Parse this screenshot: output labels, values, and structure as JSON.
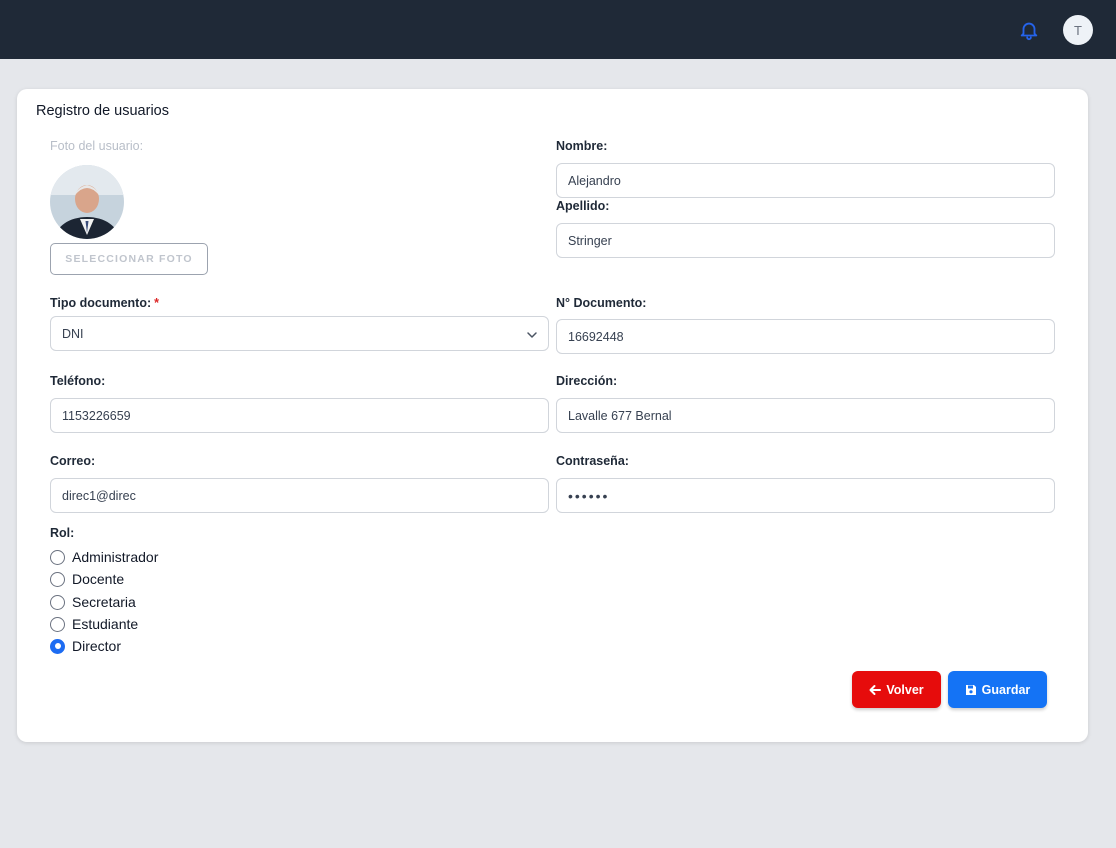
{
  "header": {
    "avatar_initial": "T",
    "icons": [
      "bell-icon"
    ],
    "accent_color": "#2563eb",
    "bar_color": "#1f2937"
  },
  "form": {
    "title": "Registro de usuarios",
    "photo": {
      "label": "Foto del usuario:",
      "button_label": "SELECCIONAR FOTO"
    },
    "nombre": {
      "label": "Nombre:",
      "value": "Alejandro"
    },
    "apellido": {
      "label": "Apellido:",
      "value": "Stringer"
    },
    "tipo_documento": {
      "label": "Tipo documento:",
      "required_mark": "*",
      "value": "DNI"
    },
    "nro_documento": {
      "label": "N° Documento:",
      "value": "16692448"
    },
    "telefono": {
      "label": "Teléfono:",
      "value": "1153226659"
    },
    "direccion": {
      "label": "Dirección:",
      "value": "Lavalle 677 Bernal"
    },
    "correo": {
      "label": "Correo:",
      "value": "direc1@direc"
    },
    "contrasena": {
      "label": "Contraseña:",
      "value": "••••••"
    },
    "rol": {
      "label": "Rol:",
      "options": [
        {
          "label": "Administrador",
          "checked": false
        },
        {
          "label": "Docente",
          "checked": false
        },
        {
          "label": "Secretaria",
          "checked": false
        },
        {
          "label": "Estudiante",
          "checked": false
        },
        {
          "label": "Director",
          "checked": true
        }
      ]
    },
    "buttons": {
      "volver": {
        "label": "Volver",
        "icon": "arrow-left-icon",
        "color": "#e60c0c"
      },
      "guardar": {
        "label": "Guardar",
        "icon": "floppy-disk-icon",
        "color": "#1473f5"
      }
    }
  }
}
